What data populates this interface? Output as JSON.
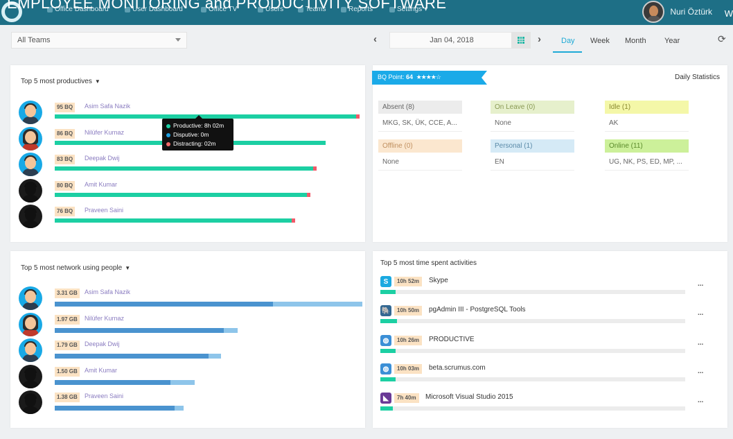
{
  "header": {
    "overlay_title": "EMPLOYEE MONITORING and PRODUCTIVITY SOFTWARE",
    "nav": [
      {
        "label": "Office Dashboard",
        "icon": "dashboard-icon"
      },
      {
        "label": "User Dashboard",
        "icon": "user-icon"
      },
      {
        "label": "Office TV",
        "icon": "tv-icon"
      },
      {
        "label": "Users",
        "icon": "users-icon"
      },
      {
        "label": "Teams",
        "icon": "teams-icon"
      },
      {
        "label": "Reports",
        "icon": "reports-icon"
      },
      {
        "label": "Settings",
        "icon": "settings-icon"
      }
    ],
    "settings_caret": "▾",
    "user_name": "Nuri Öztürk",
    "edge_glyph": "W"
  },
  "filters": {
    "team_select": "All Teams",
    "date": "Jan 04, 2018",
    "prev": "‹",
    "next": "›",
    "periods": [
      "Day",
      "Week",
      "Month",
      "Year"
    ],
    "active_period": "Day",
    "refresh": "⟳"
  },
  "productive": {
    "title": "Top 5 most productives",
    "people": [
      {
        "badge": "95 BQ",
        "name": "Asim Safa Nazik",
        "productive": 0.98,
        "distracting": 0.012,
        "avatar": "male"
      },
      {
        "badge": "86 BQ",
        "name": "Nilüfer Kurnaz",
        "productive": 0.88,
        "distracting": 0.0,
        "avatar": "female"
      },
      {
        "badge": "83 BQ",
        "name": "Deepak Dwij",
        "productive": 0.84,
        "distracting": 0.012,
        "avatar": "male"
      },
      {
        "badge": "80 BQ",
        "name": "Amit Kumar",
        "productive": 0.82,
        "distracting": 0.012,
        "avatar": "silhouette"
      },
      {
        "badge": "76 BQ",
        "name": "Praveen Saini",
        "productive": 0.77,
        "distracting": 0.012,
        "avatar": "silhouette"
      }
    ],
    "tooltip": {
      "productive": "Productive: 8h 02m",
      "disputive": "Disputive: 0m",
      "distracting": "Distracting: 02m"
    }
  },
  "network": {
    "title": "Top 5 most network using people",
    "people": [
      {
        "badge": "3.31 GB",
        "name": "Asim Safa Nazik",
        "total": 1.0,
        "dark": 0.71,
        "avatar": "male"
      },
      {
        "badge": "1.97 GB",
        "name": "Nilüfer Kurnaz",
        "total": 0.595,
        "dark": 0.55,
        "avatar": "female"
      },
      {
        "badge": "1.79 GB",
        "name": "Deepak Dwij",
        "total": 0.54,
        "dark": 0.5,
        "avatar": "male"
      },
      {
        "badge": "1.50 GB",
        "name": "Amit Kumar",
        "total": 0.455,
        "dark": 0.375,
        "avatar": "silhouette"
      },
      {
        "badge": "1.38 GB",
        "name": "Praveen Saini",
        "total": 0.42,
        "dark": 0.39,
        "avatar": "silhouette"
      }
    ]
  },
  "stats": {
    "bq_label": "BQ Point:",
    "bq_value": "64",
    "stars": "★★★★☆",
    "title": "Daily Statistics",
    "cells": [
      {
        "label": "Absent (8)",
        "value": "MKG, SK, ÜK, CCE, A...",
        "color": "#ececec",
        "text": "#666"
      },
      {
        "label": "On Leave (0)",
        "value": "None",
        "color": "#e6f0cc",
        "text": "#8a9a55"
      },
      {
        "label": "Idle (1)",
        "value": "AK",
        "color": "#f4f7a8",
        "text": "#8a8a30"
      },
      {
        "label": "Offline (0)",
        "value": "None",
        "color": "#fbe7cf",
        "text": "#c09060"
      },
      {
        "label": "Personal (1)",
        "value": "EN",
        "color": "#d5eaf6",
        "text": "#5a8aa8"
      },
      {
        "label": "Online (11)",
        "value": "UG, NK, PS, ED, MP, ...",
        "color": "#ccf09a",
        "text": "#5a8a2a"
      }
    ]
  },
  "activities": {
    "title": "Top 5 most time spent activities",
    "items": [
      {
        "badge": "10h 52m",
        "name": "Skype",
        "fill": 0.05,
        "icon": "skype-icon",
        "color": "#1aa9e0",
        "glyph": "S"
      },
      {
        "badge": "10h 50m",
        "name": "pgAdmin III - PostgreSQL Tools",
        "fill": 0.055,
        "icon": "postgres-icon",
        "color": "#336791",
        "glyph": "🐘"
      },
      {
        "badge": "10h 26m",
        "name": "PRODUCTIVE",
        "fill": 0.05,
        "icon": "globe-icon",
        "color": "#3b8fd6",
        "glyph": "◍"
      },
      {
        "badge": "10h 03m",
        "name": "beta.scrumus.com",
        "fill": 0.05,
        "icon": "globe-icon",
        "color": "#3b8fd6",
        "glyph": "◍"
      },
      {
        "badge": "7h 40m",
        "name": "Microsoft Visual Studio 2015",
        "fill": 0.04,
        "icon": "visual-studio-icon",
        "color": "#6a3a96",
        "glyph": "◣"
      }
    ],
    "more": "..."
  }
}
